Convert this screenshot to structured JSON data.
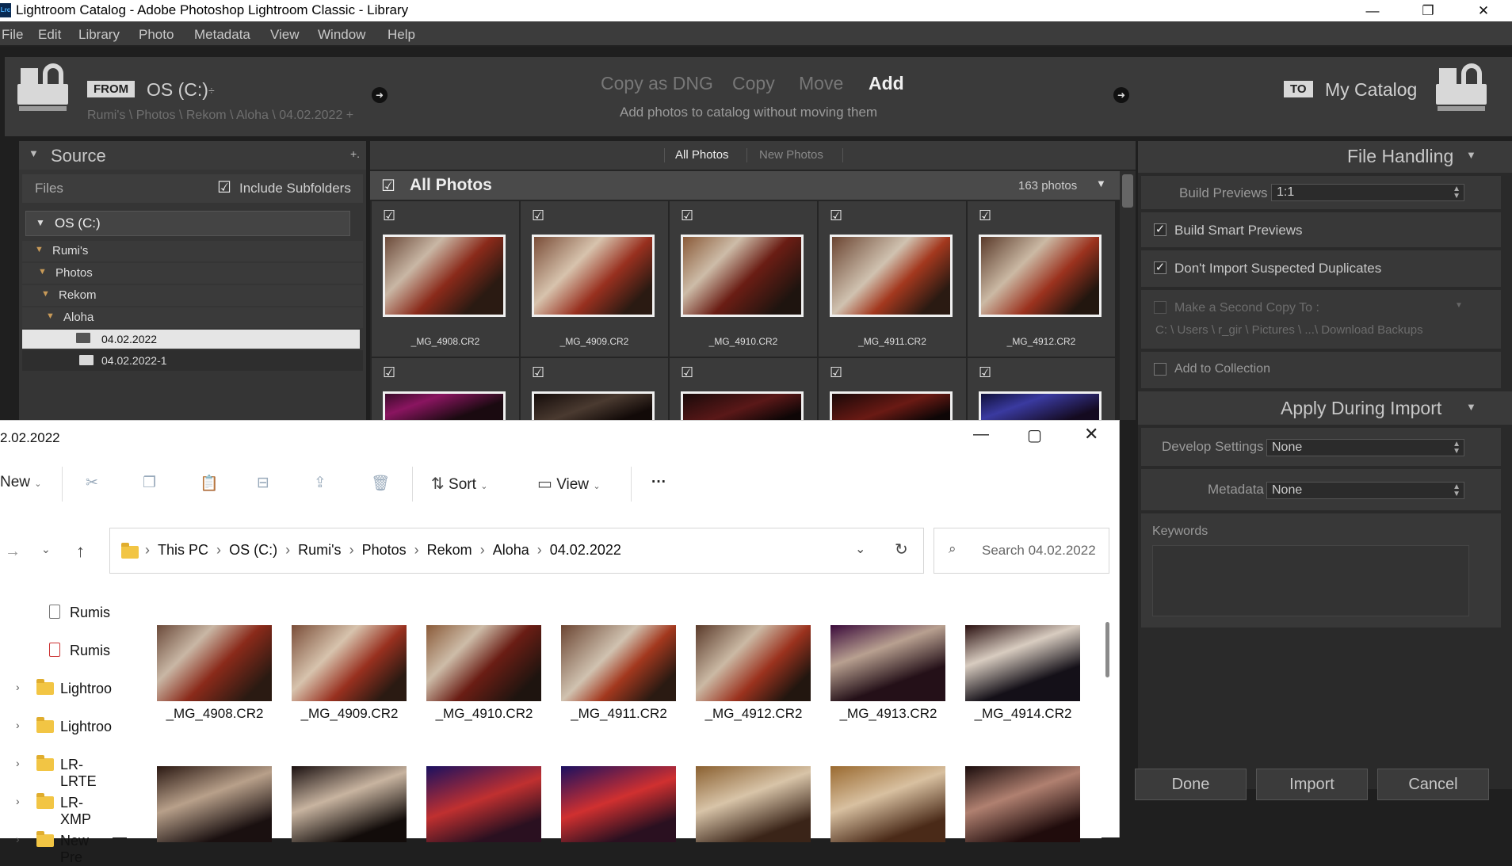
{
  "titlebar": {
    "app_icon": "Lrc",
    "title": "Lightroom Catalog - Adobe Photoshop Lightroom Classic - Library",
    "minimize": "—",
    "maximize": "❐",
    "close": "✕"
  },
  "menu": [
    "File",
    "Edit",
    "Library",
    "Photo",
    "Metadata",
    "View",
    "Window",
    "Help"
  ],
  "header": {
    "from_tag": "FROM",
    "source_drive": "OS (C:)",
    "source_caret": "÷",
    "source_path": "Rumi's \\ Photos \\ Rekom \\ Aloha \\ 04.02.2022 +",
    "modes": [
      "Copy as DNG",
      "Copy",
      "Move",
      "Add"
    ],
    "active_mode": "Add",
    "mode_description": "Add photos to catalog without moving them",
    "to_tag": "TO",
    "destination": "My Catalog"
  },
  "source_panel": {
    "title": "Source",
    "add": "+.",
    "files_label": "Files",
    "include_subfolders": "Include Subfolders",
    "drive": "OS (C:)",
    "tree": [
      {
        "label": "Rumi's",
        "level": 0
      },
      {
        "label": "Photos",
        "level": 1
      },
      {
        "label": "Rekom",
        "level": 2
      },
      {
        "label": "Aloha",
        "level": 3
      },
      {
        "label": "04.02.2022",
        "level": 4,
        "selected": true
      },
      {
        "label": "04.02.2022-1",
        "level": 4,
        "selected": false
      }
    ]
  },
  "grid": {
    "tabs": [
      "All Photos",
      "New Photos"
    ],
    "active_tab": "All Photos",
    "header_title": "All Photos",
    "count": "163 photos",
    "row1": [
      {
        "name": "_MG_4908.CR2",
        "checked": true
      },
      {
        "name": "_MG_4909.CR2",
        "checked": true
      },
      {
        "name": "_MG_4910.CR2",
        "checked": true
      },
      {
        "name": "_MG_4911.CR2",
        "checked": true
      },
      {
        "name": "_MG_4912.CR2",
        "checked": true
      }
    ]
  },
  "right_panel": {
    "file_handling": "File Handling",
    "build_previews_label": "Build Previews",
    "build_previews_value": "1:1",
    "build_smart_previews": "Build Smart Previews",
    "dont_import_duplicates": "Don't Import Suspected Duplicates",
    "second_copy": "Make a Second Copy To :",
    "second_copy_path": "C: \\ Users \\ r_gir \\ Pictures \\ ...\\ Download Backups",
    "add_to_collection": "Add to Collection",
    "apply_during_import": "Apply During Import",
    "develop_label": "Develop Settings",
    "develop_value": "None",
    "metadata_label": "Metadata",
    "metadata_value": "None",
    "keywords_label": "Keywords"
  },
  "footer": {
    "done": "Done",
    "import": "Import",
    "cancel": "Cancel"
  },
  "explorer": {
    "title": "2.02.2022",
    "commands": {
      "new": "New",
      "sort": "Sort",
      "view": "View",
      "more": "···"
    },
    "breadcrumb": [
      "This PC",
      "OS (C:)",
      "Rumi's",
      "Photos",
      "Rekom",
      "Aloha",
      "04.02.2022"
    ],
    "search_placeholder": "Search 04.02.2022",
    "nav": [
      "Rumis",
      "Rumis",
      "Lightroo",
      "Lightroo",
      "LR-LRTE",
      "LR-XMP",
      "New Pre"
    ],
    "files": [
      "_MG_4908.CR2",
      "_MG_4909.CR2",
      "_MG_4910.CR2",
      "_MG_4911.CR2",
      "_MG_4912.CR2",
      "_MG_4913.CR2",
      "_MG_4914.CR2"
    ]
  }
}
